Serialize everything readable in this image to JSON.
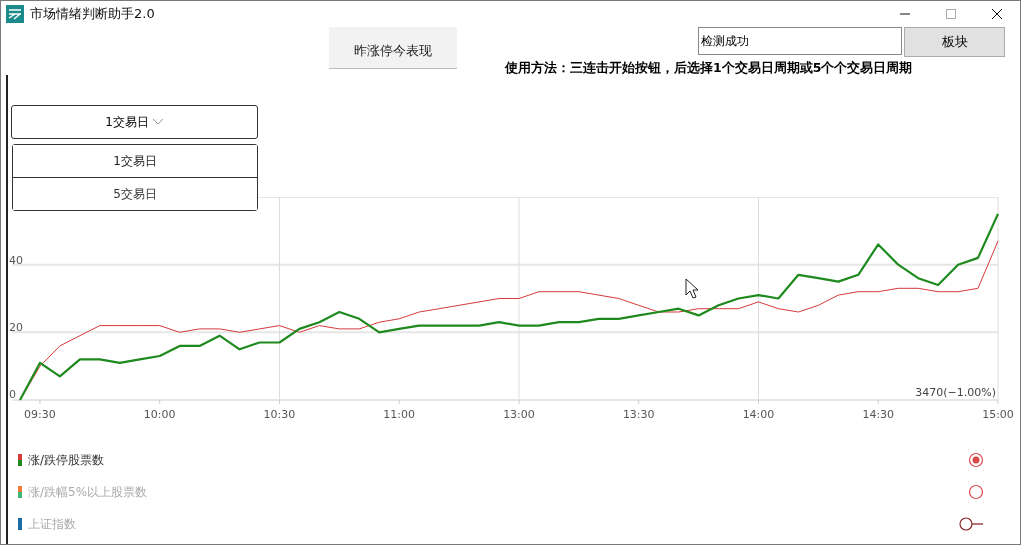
{
  "window": {
    "title": "市场情绪判断助手2.0"
  },
  "toolbar": {
    "tab": {
      "label": "昨涨停今表现",
      "selected": true
    },
    "status_field": {
      "value": "检测成功"
    },
    "sector_button": {
      "label": "板块"
    }
  },
  "instructions": "使用方法：三连击开始按钮，后选择1个交易日周期或5个个交易日周期",
  "period_dropdown": {
    "value": "1交易日",
    "expanded": true,
    "options": [
      {
        "label": "1交易日",
        "selected": true
      },
      {
        "label": "5交易日",
        "selected": false
      }
    ]
  },
  "chart": {
    "corner_label": "3470(−1.00%)",
    "chart_data": {
      "type": "line",
      "categories": [
        null,
        "09:30",
        null,
        null,
        null,
        null,
        null,
        "10:00",
        null,
        null,
        null,
        null,
        null,
        "10:30",
        null,
        null,
        null,
        null,
        null,
        "11:00",
        null,
        null,
        null,
        null,
        null,
        "13:00",
        null,
        null,
        null,
        null,
        null,
        "13:30",
        null,
        null,
        null,
        null,
        null,
        "14:00",
        null,
        null,
        null,
        null,
        null,
        "14:30",
        null,
        null,
        null,
        null,
        null,
        "15:00"
      ],
      "series": [
        {
          "color": "#d63a3a",
          "values": [
            0,
            10,
            16,
            19,
            22,
            22,
            22,
            22,
            20,
            21,
            21,
            20,
            21,
            22,
            20,
            22,
            21,
            21,
            23,
            24,
            26,
            27,
            28,
            29,
            30,
            30,
            32,
            32,
            32,
            31,
            30,
            28,
            26,
            26,
            27,
            27,
            27,
            29,
            27,
            26,
            28,
            31,
            32,
            32,
            33,
            33,
            32,
            32,
            33,
            47
          ]
        },
        {
          "color": "#1e8a1e",
          "values": [
            0,
            11,
            7,
            12,
            12,
            11,
            12,
            13,
            16,
            16,
            19,
            15,
            17,
            17,
            21,
            23,
            26,
            24,
            20,
            21,
            22,
            22,
            22,
            22,
            23,
            22,
            22,
            23,
            23,
            24,
            24,
            25,
            26,
            27,
            25,
            28,
            30,
            31,
            30,
            37,
            36,
            35,
            37,
            46,
            40,
            36,
            34,
            40,
            42,
            55
          ]
        }
      ],
      "ylim": [
        0,
        60
      ],
      "yticks": [
        0,
        20,
        40
      ],
      "grid": true
    }
  },
  "legend": [
    {
      "kind": "radio",
      "label": "涨/跌停股票数",
      "on": true,
      "markers": [
        {
          "color": "#d63a3a"
        },
        {
          "color": "#1e8a1e"
        }
      ]
    },
    {
      "kind": "radio",
      "label": "涨/跌幅5%以上股票数",
      "on": false,
      "markers": [
        {
          "color": "#f07a3a"
        },
        {
          "color": "#3ab87a"
        }
      ]
    },
    {
      "kind": "line",
      "label": "上证指数",
      "on": false,
      "markers": [
        {
          "color": "#1a6fa8"
        }
      ]
    }
  ]
}
